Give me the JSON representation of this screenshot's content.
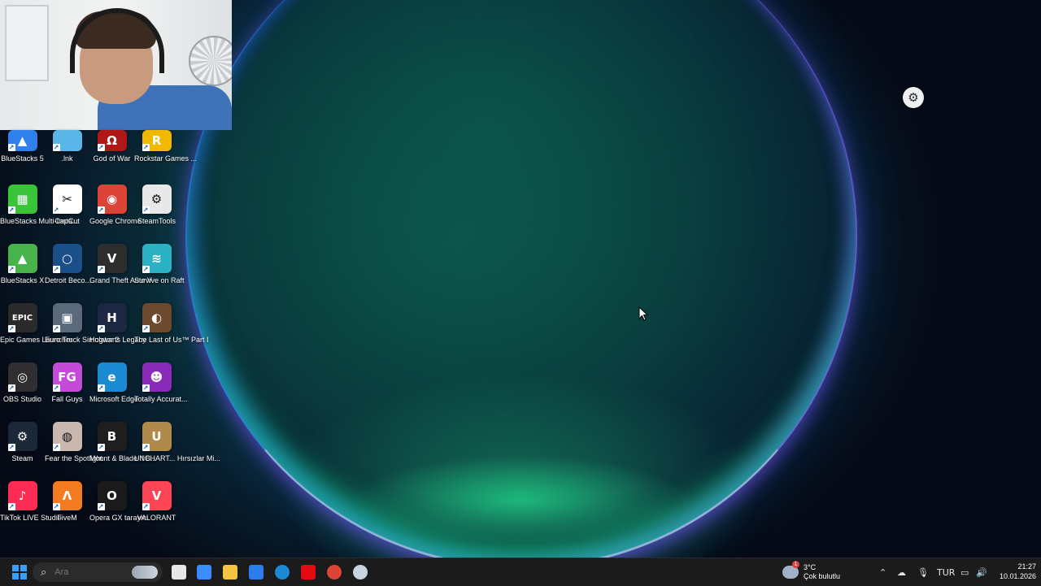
{
  "desktop_icons": [
    {
      "label": "BlueStacks 5",
      "color": "#2f80ed",
      "glyph": "▲"
    },
    {
      "label": ".lnk",
      "color": "#5ab6e8",
      "glyph": ""
    },
    {
      "label": "God of War",
      "color": "#b01818",
      "glyph": "Ω"
    },
    {
      "label": "Rockstar Games ...",
      "color": "#f2b800",
      "glyph": "R"
    },
    {
      "label": "BlueStacks Multi-Insta...",
      "color": "#3ac43a",
      "glyph": "▦"
    },
    {
      "label": "CapCut",
      "color": "#ffffff",
      "glyph": "✂"
    },
    {
      "label": "Google Chrome",
      "color": "#db4437",
      "glyph": "◉"
    },
    {
      "label": "SteamTools",
      "color": "#e8e8e8",
      "glyph": "⚙"
    },
    {
      "label": "BlueStacks X",
      "color": "#47b34a",
      "glyph": "▲"
    },
    {
      "label": "Detroit Beco...",
      "color": "#1a4f8a",
      "glyph": "○"
    },
    {
      "label": "Grand Theft Auto V",
      "color": "#2d2d2d",
      "glyph": "V"
    },
    {
      "label": "Survive on Raft",
      "color": "#2bb0c4",
      "glyph": "≋"
    },
    {
      "label": "Epic Games Launcher",
      "color": "#2a2a2a",
      "glyph": "EPIC"
    },
    {
      "label": "Euro Truck Simulator 2",
      "color": "#5a6a7a",
      "glyph": "▣"
    },
    {
      "label": "Hogwarts Legacy",
      "color": "#1c2742",
      "glyph": "H"
    },
    {
      "label": "The Last of Us™ Part I",
      "color": "#6b4a2e",
      "glyph": "◐"
    },
    {
      "label": "OBS Studio",
      "color": "#302e31",
      "glyph": "◎"
    },
    {
      "label": "Fall Guys",
      "color": "#c44ad8",
      "glyph": "FG"
    },
    {
      "label": "Microsoft Edge",
      "color": "#1a8bd3",
      "glyph": "e"
    },
    {
      "label": "Totally Accurat...",
      "color": "#8a2ab8",
      "glyph": "☻"
    },
    {
      "label": "Steam",
      "color": "#1b2838",
      "glyph": "⚙"
    },
    {
      "label": "Fear the Spotlight",
      "color": "#c8b8b0",
      "glyph": "◍"
    },
    {
      "label": "Mount & Blade II B...",
      "color": "#1e1e1e",
      "glyph": "B"
    },
    {
      "label": "UNCHART... Hırsızlar Mi...",
      "color": "#b08a4a",
      "glyph": "U"
    },
    {
      "label": "TikTok LIVE Studio",
      "color": "#fe2c55",
      "glyph": "♪"
    },
    {
      "label": "FiveM",
      "color": "#f47b20",
      "glyph": "Λ"
    },
    {
      "label": "Opera GX tarayıcı",
      "color": "#1a1a1a",
      "glyph": "O"
    },
    {
      "label": "VALORANT",
      "color": "#fd4556",
      "glyph": "V"
    }
  ],
  "taskbar": {
    "search_placeholder": "Ara",
    "pinned": [
      {
        "name": "task-view",
        "color": "#e8e8e8"
      },
      {
        "name": "copilot",
        "color": "#3b8cff"
      },
      {
        "name": "file-explorer",
        "color": "#f5c542"
      },
      {
        "name": "microsoft-store",
        "color": "#2b7de9"
      },
      {
        "name": "edge",
        "color": "#1a8bd3"
      },
      {
        "name": "netflix",
        "color": "#e50914"
      },
      {
        "name": "chrome",
        "color": "#db4437"
      },
      {
        "name": "steam",
        "color": "#c7d5e0"
      }
    ],
    "weather": {
      "temp": "3°C",
      "desc": "Çok bulutlu",
      "badge": "1"
    },
    "language": "TUR",
    "time": "21:27",
    "date": "10.01.2026"
  }
}
